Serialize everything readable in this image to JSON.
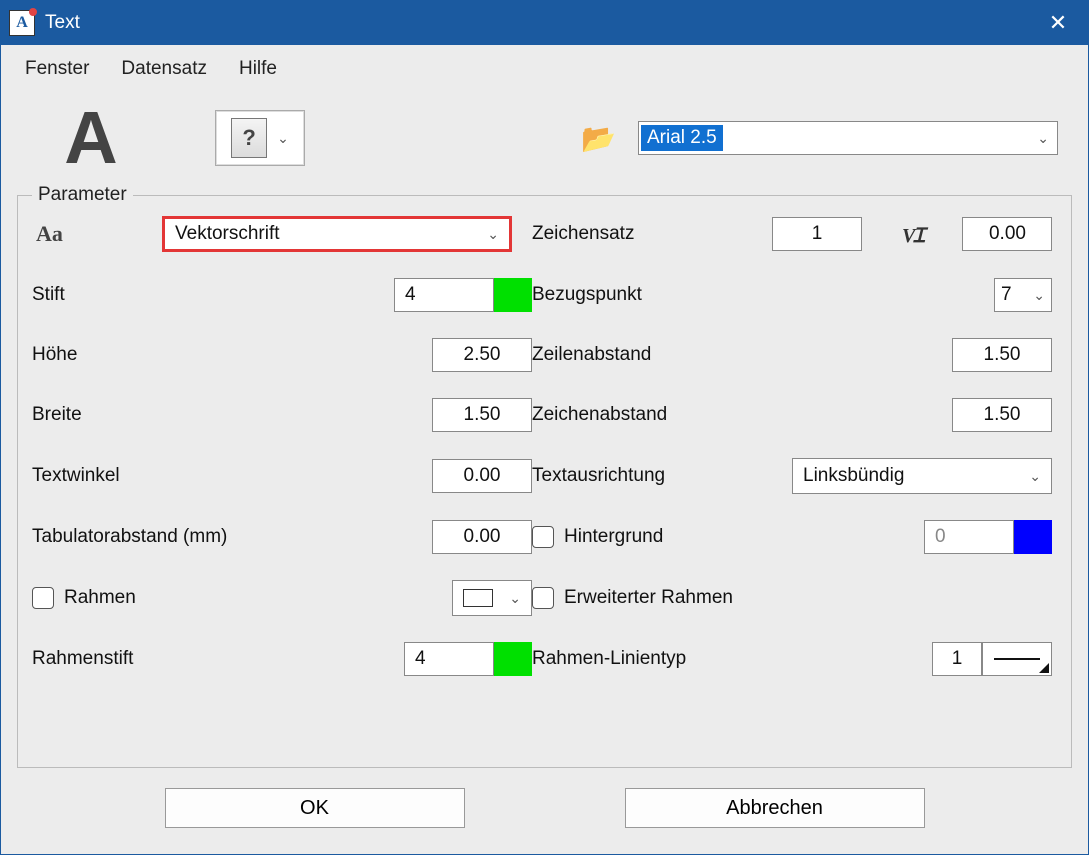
{
  "titlebar": {
    "title": "Text",
    "app_icon_letter": "A"
  },
  "menu": {
    "fenster": "Fenster",
    "datensatz": "Datensatz",
    "hilfe": "Hilfe"
  },
  "toprow": {
    "big_a": "A",
    "preset_placeholder": "?",
    "font_selected": "Arial 2.5"
  },
  "fieldset_title": "Parameter",
  "labels": {
    "aa": "Aa",
    "stift": "Stift",
    "hoehe": "Höhe",
    "breite": "Breite",
    "textwinkel": "Textwinkel",
    "tabulator": "Tabulatorabstand (mm)",
    "rahmen": "Rahmen",
    "rahmenstift": "Rahmenstift",
    "zeichensatz": "Zeichensatz",
    "bezugspunkt": "Bezugspunkt",
    "zeilenabstand": "Zeilenabstand",
    "zeichenabstand": "Zeichenabstand",
    "textausrichtung": "Textausrichtung",
    "hintergrund": "Hintergrund",
    "erweitert_rahmen": "Erweiterter Rahmen",
    "rahmen_linientyp": "Rahmen-Linientyp"
  },
  "values": {
    "schriftart": "Vektorschrift",
    "stift": "4",
    "hoehe": "2.50",
    "breite": "1.50",
    "textwinkel": "0.00",
    "tabulator": "0.00",
    "rahmenstift": "4",
    "zeichensatz": "1",
    "slant": "0.00",
    "bezugspunkt": "7",
    "zeilenabstand": "1.50",
    "zeichenabstand": "1.50",
    "textausrichtung": "Linksbündig",
    "hintergrund_stift": "0",
    "rahmen_linientyp": "1"
  },
  "colors": {
    "stift": "#00e000",
    "rahmenstift": "#00e000",
    "hintergrund": "#0000ff"
  },
  "buttons": {
    "ok": "OK",
    "cancel": "Abbrechen"
  }
}
